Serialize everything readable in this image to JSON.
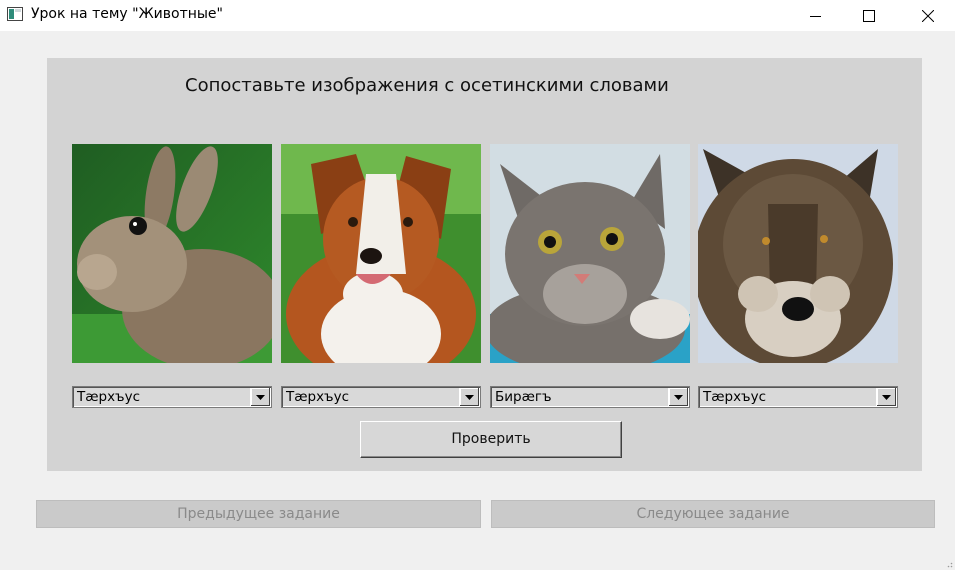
{
  "window": {
    "title": "Урок на тему \"Животные\""
  },
  "task": {
    "heading": "Сопоставьте изображения с осетинскими словами"
  },
  "cards": [
    {
      "animal_icon": "rabbit-photo",
      "selected": "Тæрхъус"
    },
    {
      "animal_icon": "dog-photo",
      "selected": "Тæрхъус"
    },
    {
      "animal_icon": "cat-photo",
      "selected": "Бирæгъ"
    },
    {
      "animal_icon": "wolf-photo",
      "selected": "Тæрхъус"
    }
  ],
  "buttons": {
    "check": "Проверить",
    "previous": "Предыдущее задание",
    "next": "Следующее задание"
  },
  "colors": {
    "panel": "#d3d3d3",
    "window": "#f0f0f0",
    "disabled_text": "#8a8a8a"
  }
}
